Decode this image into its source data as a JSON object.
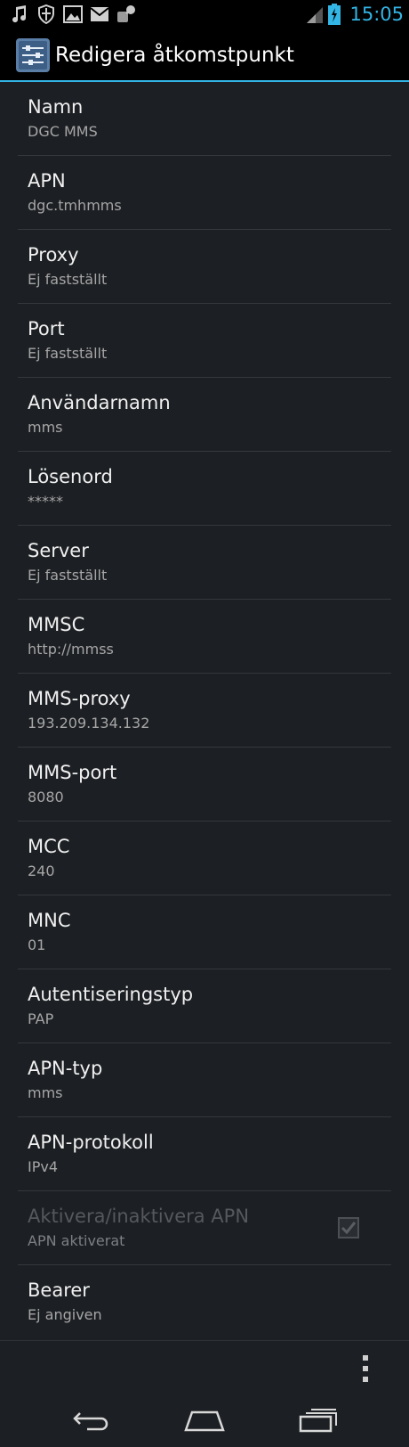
{
  "status_bar": {
    "time": "15:05",
    "icons": [
      "music-note-icon",
      "shield-icon",
      "picture-icon",
      "mail-icon",
      "phone-link-icon"
    ],
    "right_icons": [
      "signal-icon",
      "battery-charging-icon"
    ]
  },
  "action_bar": {
    "title": "Redigera åtkomstpunkt",
    "icon": "settings-sliders-icon"
  },
  "preferences": [
    {
      "title": "Namn",
      "summary": "DGC MMS"
    },
    {
      "title": "APN",
      "summary": "dgc.tmhmms"
    },
    {
      "title": "Proxy",
      "summary": "Ej fastställt"
    },
    {
      "title": "Port",
      "summary": "Ej fastställt"
    },
    {
      "title": "Användarnamn",
      "summary": "mms"
    },
    {
      "title": "Lösenord",
      "summary": "*****"
    },
    {
      "title": "Server",
      "summary": "Ej fastställt"
    },
    {
      "title": "MMSC",
      "summary": "http://mmss"
    },
    {
      "title": "MMS-proxy",
      "summary": "193.209.134.132"
    },
    {
      "title": "MMS-port",
      "summary": "8080"
    },
    {
      "title": "MCC",
      "summary": "240"
    },
    {
      "title": "MNC",
      "summary": "01"
    },
    {
      "title": "Autentiseringstyp",
      "summary": "PAP"
    },
    {
      "title": "APN-typ",
      "summary": "mms"
    },
    {
      "title": "APN-protokoll",
      "summary": "IPv4"
    },
    {
      "title": "Aktivera/inaktivera APN",
      "summary": "APN aktiverat",
      "checked": true,
      "enabled": false
    },
    {
      "title": "Bearer",
      "summary": "Ej angiven"
    }
  ],
  "menu": {
    "overflow_icon": "overflow-menu-icon"
  },
  "nav_bar": {
    "icons": [
      "back-icon",
      "home-icon",
      "recent-apps-icon"
    ]
  },
  "colors": {
    "accent": "#33b5e5",
    "background": "#1c1f23"
  }
}
